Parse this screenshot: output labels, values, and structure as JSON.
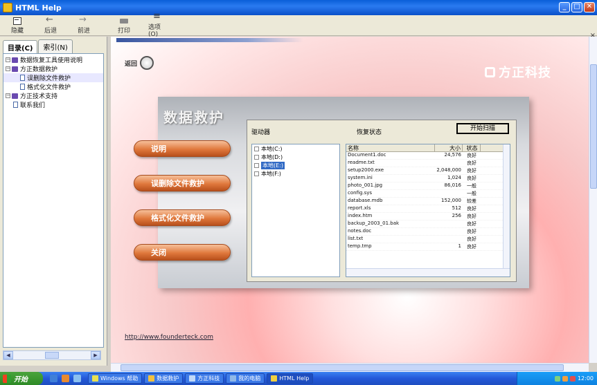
{
  "window": {
    "title": "HTML Help",
    "min_label": "_",
    "max_label": "□",
    "close_label": "✕"
  },
  "toolbar": {
    "hide_label": "隐藏",
    "back_label": "后退",
    "forward_label": "前进",
    "print_label": "打印",
    "options_label": "选项(O)",
    "marker": "×"
  },
  "nav": {
    "tabs": [
      "目录(C)",
      "索引(N)"
    ],
    "tree": [
      {
        "level": 0,
        "type": "book",
        "toggle": "−",
        "label": "数据恢复工具使用说明"
      },
      {
        "level": 0,
        "type": "book",
        "toggle": "−",
        "label": "方正数据救护"
      },
      {
        "level": 1,
        "type": "doc",
        "label": "误删除文件救护"
      },
      {
        "level": 1,
        "type": "doc",
        "label": "格式化文件救护"
      },
      {
        "level": 0,
        "type": "book",
        "toggle": "−",
        "label": "方正技术支持"
      },
      {
        "level": 1,
        "type": "doc",
        "label": "联系我们"
      }
    ]
  },
  "content": {
    "back_text": "返回",
    "brand": "方正科技",
    "panel_title": "数据救护",
    "drive_label": "驱动器",
    "status_label": "恢复状态",
    "start_button": "开始扫描",
    "drives": [
      {
        "label": "本地(C:)"
      },
      {
        "label": "本地(D:)"
      },
      {
        "label": "本地(E:)",
        "highlight": "(E:)"
      },
      {
        "label": "本地(F:)"
      }
    ],
    "file_columns": [
      "名称",
      "大小",
      "状态"
    ],
    "files": [
      [
        "Document1.doc",
        "24,576",
        "良好"
      ],
      [
        "readme.txt",
        "",
        "良好"
      ],
      [
        "setup2000.exe",
        "2,048,000",
        "良好"
      ],
      [
        "system.ini",
        "1,024",
        "良好"
      ],
      [
        "photo_001.jpg",
        "86,016",
        "一般"
      ],
      [
        "config.sys",
        "",
        "一般"
      ],
      [
        "database.mdb",
        "152,000",
        "较差"
      ],
      [
        "report.xls",
        "512",
        "良好"
      ],
      [
        "index.htm",
        "256",
        "良好"
      ],
      [
        "backup_2003_01.bak",
        "",
        "良好"
      ],
      [
        "notes.doc",
        "",
        "良好"
      ],
      [
        "list.txt",
        "",
        "良好"
      ],
      [
        "temp.tmp",
        "1",
        "良好"
      ]
    ],
    "buttons": [
      "说明",
      "误删除文件救护",
      "格式化文件救护",
      "关闭"
    ],
    "homepage": "http://www.founderteck.com"
  },
  "taskbar": {
    "start": "开始",
    "tasks": [
      "Windows 帮助",
      "数据救护",
      "方正科技",
      "我的电脑",
      "HTML Help"
    ],
    "clock": "12:00"
  }
}
